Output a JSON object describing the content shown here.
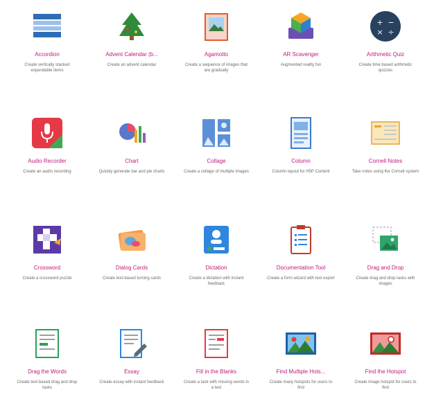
{
  "content_types": [
    {
      "title": "Accordion",
      "desc": "Create vertically stacked expandable items",
      "icon": "accordion-icon"
    },
    {
      "title": "Advent Calendar (b...",
      "desc": "Create an advent calendar",
      "icon": "christmas-tree-icon"
    },
    {
      "title": "Agamotto",
      "desc": "Create a sequence of images that are gradually",
      "icon": "picture-frame-icon"
    },
    {
      "title": "AR Scavenger",
      "desc": "Augmented reality fun",
      "icon": "ar-cube-icon"
    },
    {
      "title": "Arithmetic Quiz",
      "desc": "Create time based arithmetic quizzes",
      "icon": "arithmetic-icon"
    },
    {
      "title": "Audio Recorder",
      "desc": "Create an audio recording",
      "icon": "microphone-icon"
    },
    {
      "title": "Chart",
      "desc": "Quickly generate bar and pie charts",
      "icon": "chart-icon"
    },
    {
      "title": "Collage",
      "desc": "Create a collage of multiple images",
      "icon": "collage-icon"
    },
    {
      "title": "Column",
      "desc": "Column layout for H5P Content",
      "icon": "column-icon"
    },
    {
      "title": "Cornell Notes",
      "desc": "Take notes using the Cornell system",
      "icon": "notes-icon"
    },
    {
      "title": "Crossword",
      "desc": "Create a crossword puzzle",
      "icon": "crossword-icon"
    },
    {
      "title": "Dialog Cards",
      "desc": "Create text-based turning cards",
      "icon": "dialog-cards-icon"
    },
    {
      "title": "Dictation",
      "desc": "Create a dictation with instant feedback",
      "icon": "dictation-icon"
    },
    {
      "title": "Documentation Tool",
      "desc": "Create a form wizard with text export",
      "icon": "clipboard-icon"
    },
    {
      "title": "Drag and Drop",
      "desc": "Create drag and drop tasks with images",
      "icon": "drag-drop-icon"
    },
    {
      "title": "Drag the Words",
      "desc": "Create text-based drag and drop tasks",
      "icon": "drag-words-icon"
    },
    {
      "title": "Essay",
      "desc": "Create essay with instant feedback",
      "icon": "essay-icon"
    },
    {
      "title": "Fill in the Blanks",
      "desc": "Create a task with missing words in a text",
      "icon": "fill-blanks-icon"
    },
    {
      "title": "Find Multiple Hots...",
      "desc": "Create many hotspots for users to find",
      "icon": "multiple-hotspots-icon"
    },
    {
      "title": "Find the Hotspot",
      "desc": "Create image hotspot for users to find",
      "icon": "hotspot-icon"
    }
  ]
}
